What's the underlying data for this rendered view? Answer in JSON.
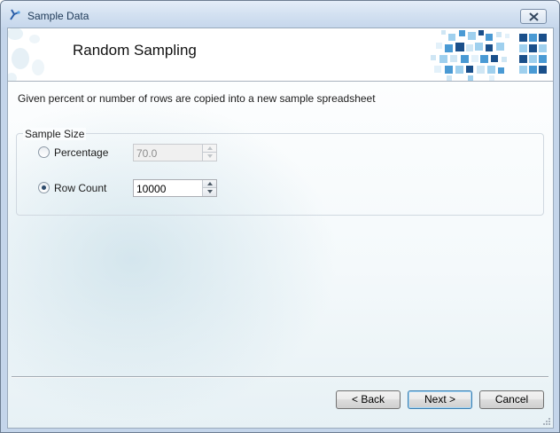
{
  "window": {
    "title": "Sample Data",
    "icon": "app-wizard-icon",
    "close_icon": "close-icon"
  },
  "banner": {
    "title": "Random Sampling",
    "graphic": "pixel-mosaic-graphic"
  },
  "description": "Given percent or number of rows are copied into a new sample spreadsheet",
  "sample_size": {
    "legend": "Sample Size",
    "percentage": {
      "label": "Percentage",
      "value": "70.0",
      "selected": false,
      "enabled": false
    },
    "row_count": {
      "label": "Row Count",
      "value": "10000",
      "selected": true,
      "enabled": true
    }
  },
  "buttons": {
    "back": "< Back",
    "next": "Next >",
    "cancel": "Cancel"
  },
  "colors": {
    "mosaic_dark": "#1a4f8a",
    "mosaic_mid": "#4a9ad4",
    "mosaic_light": "#9fd0ee",
    "title_text": "#1e3957",
    "default_button_border": "#3c7fb1"
  }
}
